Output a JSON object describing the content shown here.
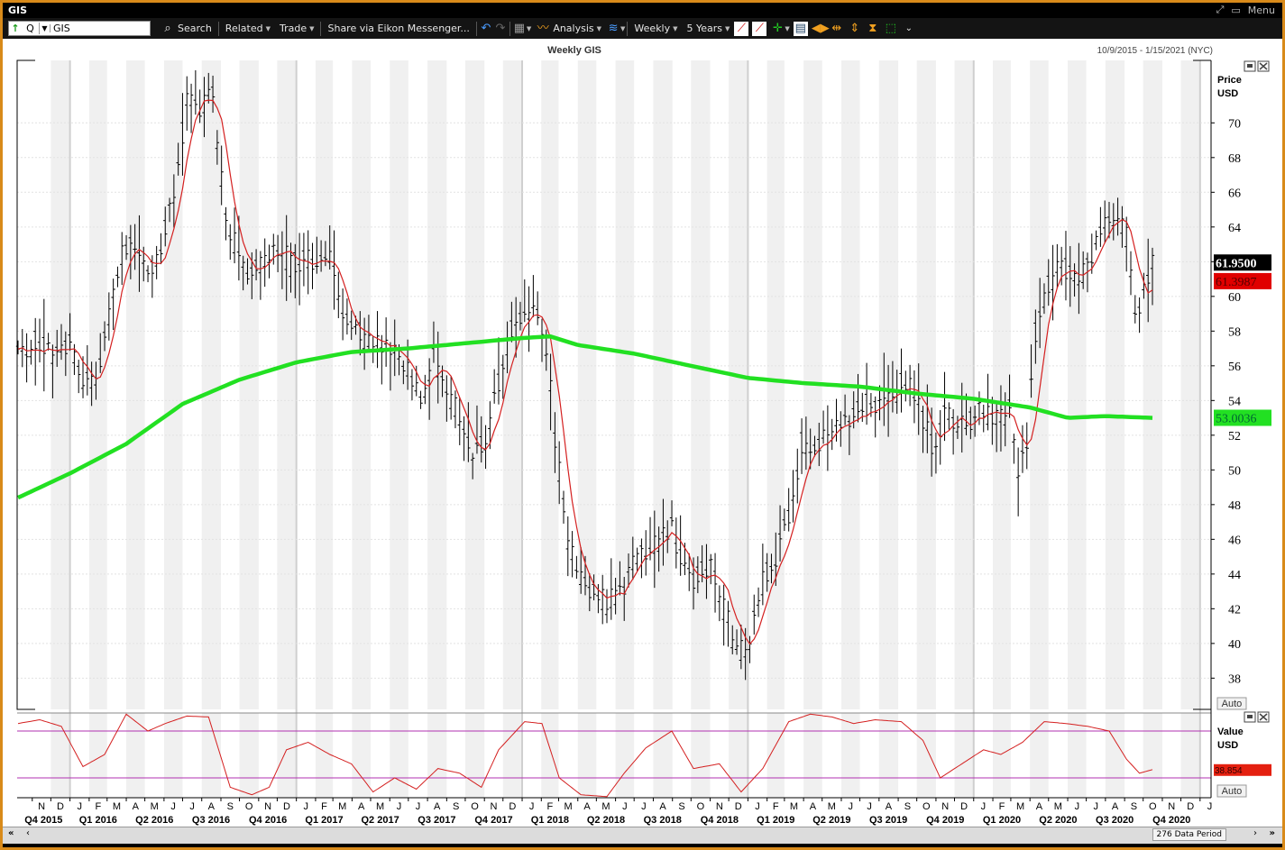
{
  "window": {
    "title": "GIS",
    "menu_label": "Menu"
  },
  "toolbar": {
    "ric_mode": "Q",
    "ric_value": "GIS",
    "search": "Search",
    "related": "Related",
    "trade": "Trade",
    "share": "Share via Eikon Messenger...",
    "analysis": "Analysis",
    "interval": "Weekly",
    "range": "5 Years"
  },
  "chart": {
    "title": "Weekly GIS",
    "date_range": "10/9/2015 - 1/15/2021 (NYC)",
    "price_axis_title": "Price",
    "price_axis_unit": "USD",
    "value_axis_title": "Value",
    "value_axis_unit": "USD",
    "auto_label": "Auto",
    "auto_label_lower": "Auto",
    "data_period": "276 Data Period",
    "last_price_label": "61.9500",
    "ma_short_label": "61.3987",
    "ma_long_label": "53.0036",
    "indicator_label": "38.854"
  },
  "colors": {
    "frame": "#d88a1a",
    "price_bars": "#000000",
    "ma_short": "#d42020",
    "ma_long": "#22e022",
    "indicator": "#d42020",
    "band_lines": "#b030b0",
    "last_price_bg": "#000000",
    "ma_short_bg": "#e00000",
    "ma_long_bg": "#22e022"
  },
  "chart_data": {
    "type": "ohlc",
    "interval": "weekly",
    "y_axis": {
      "ticks": [
        38,
        40,
        42,
        44,
        46,
        48,
        50,
        52,
        54,
        56,
        58,
        60,
        62,
        64,
        66,
        68,
        70
      ],
      "ylim": [
        36.2,
        73.6
      ]
    },
    "month_ticks": [
      "N",
      "D",
      "J",
      "F",
      "M",
      "A",
      "M",
      "J",
      "J",
      "A",
      "S",
      "O",
      "N",
      "D",
      "J",
      "F",
      "M",
      "A",
      "M",
      "J",
      "J",
      "A",
      "S",
      "O",
      "N",
      "D",
      "J",
      "F",
      "M",
      "A",
      "M",
      "J",
      "J",
      "A",
      "S",
      "O",
      "N",
      "D",
      "J",
      "F",
      "M",
      "A",
      "M",
      "J",
      "J",
      "A",
      "S",
      "O",
      "N",
      "D",
      "J",
      "F",
      "M",
      "A",
      "M",
      "J",
      "J",
      "A",
      "S",
      "O",
      "N",
      "D",
      "J",
      "F",
      "M",
      "A",
      "M",
      "J",
      "J",
      "A",
      "S",
      "O",
      "N",
      "D",
      "J"
    ],
    "quarter_ticks": [
      "Q4 2015",
      "Q1 2016",
      "Q2 2016",
      "Q3 2016",
      "Q4 2016",
      "Q1 2017",
      "Q2 2017",
      "Q3 2017",
      "Q4 2017",
      "Q1 2018",
      "Q2 2018",
      "Q3 2018",
      "Q4 2018",
      "Q1 2019",
      "Q2 2019",
      "Q3 2019",
      "Q4 2019",
      "Q1 2020",
      "Q2 2020",
      "Q3 2020",
      "Q4 2020"
    ],
    "price_anchors": [
      [
        "2015-10-09",
        56.5
      ],
      [
        "2015-11-06",
        57.4
      ],
      [
        "2015-12-04",
        56.5
      ],
      [
        "2016-01-01",
        57.6
      ],
      [
        "2016-01-22",
        55.0
      ],
      [
        "2016-02-12",
        55.2
      ],
      [
        "2016-03-04",
        59.0
      ],
      [
        "2016-03-25",
        62.5
      ],
      [
        "2016-04-15",
        63.0
      ],
      [
        "2016-05-06",
        61.0
      ],
      [
        "2016-05-27",
        63.0
      ],
      [
        "2016-06-17",
        65.5
      ],
      [
        "2016-07-08",
        71.5
      ],
      [
        "2016-07-29",
        70.8
      ],
      [
        "2016-08-19",
        71.5
      ],
      [
        "2016-09-09",
        64.5
      ],
      [
        "2016-09-30",
        62.5
      ],
      [
        "2016-10-21",
        61.3
      ],
      [
        "2016-11-11",
        62.3
      ],
      [
        "2016-12-02",
        63.0
      ],
      [
        "2016-12-23",
        61.8
      ],
      [
        "2017-01-13",
        62.2
      ],
      [
        "2017-02-03",
        62.0
      ],
      [
        "2017-02-24",
        62.5
      ],
      [
        "2017-03-17",
        59.3
      ],
      [
        "2017-04-07",
        58.0
      ],
      [
        "2017-04-28",
        57.5
      ],
      [
        "2017-05-19",
        56.8
      ],
      [
        "2017-06-09",
        56.9
      ],
      [
        "2017-06-30",
        56.0
      ],
      [
        "2017-07-21",
        54.0
      ],
      [
        "2017-08-11",
        56.5
      ],
      [
        "2017-09-01",
        54.5
      ],
      [
        "2017-09-22",
        53.0
      ],
      [
        "2017-10-13",
        51.0
      ],
      [
        "2017-11-03",
        51.5
      ],
      [
        "2017-11-24",
        55.0
      ],
      [
        "2017-12-15",
        58.0
      ],
      [
        "2018-01-05",
        58.5
      ],
      [
        "2018-01-26",
        59.0
      ],
      [
        "2018-02-09",
        57.0
      ],
      [
        "2018-02-23",
        52.0
      ],
      [
        "2018-03-16",
        45.5
      ],
      [
        "2018-04-06",
        44.0
      ],
      [
        "2018-04-27",
        43.0
      ],
      [
        "2018-05-18",
        42.2
      ],
      [
        "2018-06-08",
        43.0
      ],
      [
        "2018-06-29",
        44.5
      ],
      [
        "2018-07-20",
        45.5
      ],
      [
        "2018-08-10",
        46.0
      ],
      [
        "2018-08-31",
        46.8
      ],
      [
        "2018-09-21",
        44.0
      ],
      [
        "2018-10-12",
        43.8
      ],
      [
        "2018-11-02",
        44.5
      ],
      [
        "2018-11-23",
        42.0
      ],
      [
        "2018-12-14",
        39.5
      ],
      [
        "2019-01-04",
        40.0
      ],
      [
        "2019-01-25",
        43.5
      ],
      [
        "2019-02-15",
        45.0
      ],
      [
        "2019-03-08",
        47.5
      ],
      [
        "2019-03-29",
        51.5
      ],
      [
        "2019-04-19",
        51.0
      ],
      [
        "2019-05-10",
        52.0
      ],
      [
        "2019-05-31",
        52.5
      ],
      [
        "2019-06-21",
        53.5
      ],
      [
        "2019-07-12",
        53.8
      ],
      [
        "2019-08-02",
        54.0
      ],
      [
        "2019-08-23",
        54.2
      ],
      [
        "2019-09-13",
        55.3
      ],
      [
        "2019-10-04",
        53.5
      ],
      [
        "2019-10-25",
        51.5
      ],
      [
        "2019-11-15",
        53.0
      ],
      [
        "2019-12-06",
        52.8
      ],
      [
        "2019-12-27",
        53.0
      ],
      [
        "2020-01-17",
        53.3
      ],
      [
        "2020-02-07",
        52.8
      ],
      [
        "2020-02-28",
        53.5
      ],
      [
        "2020-03-13",
        50.0
      ],
      [
        "2020-03-27",
        51.5
      ],
      [
        "2020-04-10",
        58.0
      ],
      [
        "2020-05-01",
        60.5
      ],
      [
        "2020-05-22",
        62.0
      ],
      [
        "2020-06-12",
        61.0
      ],
      [
        "2020-07-03",
        61.5
      ],
      [
        "2020-07-24",
        64.0
      ],
      [
        "2020-08-14",
        64.5
      ],
      [
        "2020-09-04",
        63.5
      ],
      [
        "2020-09-18",
        58.8
      ],
      [
        "2020-10-02",
        60.5
      ],
      [
        "2020-10-16",
        61.95
      ]
    ],
    "ma_long_anchors": [
      [
        "2015-10-09",
        48.4
      ],
      [
        "2016-01-01",
        49.8
      ],
      [
        "2016-04-01",
        51.5
      ],
      [
        "2016-07-01",
        53.8
      ],
      [
        "2016-10-01",
        55.2
      ],
      [
        "2017-01-01",
        56.2
      ],
      [
        "2017-04-01",
        56.8
      ],
      [
        "2017-07-01",
        57.0
      ],
      [
        "2017-10-01",
        57.3
      ],
      [
        "2018-01-01",
        57.6
      ],
      [
        "2018-02-15",
        57.7
      ],
      [
        "2018-04-01",
        57.2
      ],
      [
        "2018-07-01",
        56.7
      ],
      [
        "2018-10-01",
        56.0
      ],
      [
        "2019-01-01",
        55.3
      ],
      [
        "2019-04-01",
        55.0
      ],
      [
        "2019-07-01",
        54.8
      ],
      [
        "2019-10-01",
        54.4
      ],
      [
        "2020-01-01",
        54.1
      ],
      [
        "2020-04-01",
        53.6
      ],
      [
        "2020-06-01",
        53.0
      ],
      [
        "2020-08-01",
        53.1
      ],
      [
        "2020-10-16",
        53.0
      ]
    ],
    "indicator_anchors": [
      [
        "2015-10-09",
        88
      ],
      [
        "2015-11-13",
        92
      ],
      [
        "2015-12-18",
        85
      ],
      [
        "2016-01-22",
        42
      ],
      [
        "2016-02-26",
        55
      ],
      [
        "2016-04-01",
        98
      ],
      [
        "2016-05-06",
        80
      ],
      [
        "2016-06-03",
        88
      ],
      [
        "2016-07-08",
        96
      ],
      [
        "2016-08-12",
        95
      ],
      [
        "2016-09-16",
        20
      ],
      [
        "2016-10-21",
        12
      ],
      [
        "2016-11-18",
        20
      ],
      [
        "2016-12-16",
        60
      ],
      [
        "2017-01-20",
        68
      ],
      [
        "2017-02-24",
        55
      ],
      [
        "2017-03-31",
        45
      ],
      [
        "2017-05-05",
        15
      ],
      [
        "2017-06-09",
        30
      ],
      [
        "2017-07-14",
        18
      ],
      [
        "2017-08-18",
        40
      ],
      [
        "2017-09-22",
        35
      ],
      [
        "2017-10-27",
        20
      ],
      [
        "2017-11-24",
        60
      ],
      [
        "2018-01-05",
        90
      ],
      [
        "2018-02-02",
        88
      ],
      [
        "2018-03-02",
        30
      ],
      [
        "2018-04-06",
        12
      ],
      [
        "2018-05-18",
        10
      ],
      [
        "2018-06-15",
        35
      ],
      [
        "2018-07-20",
        62
      ],
      [
        "2018-08-31",
        80
      ],
      [
        "2018-10-05",
        40
      ],
      [
        "2018-11-16",
        45
      ],
      [
        "2018-12-21",
        15
      ],
      [
        "2019-01-25",
        40
      ],
      [
        "2019-03-08",
        90
      ],
      [
        "2019-04-12",
        98
      ],
      [
        "2019-05-17",
        95
      ],
      [
        "2019-06-21",
        88
      ],
      [
        "2019-07-26",
        92
      ],
      [
        "2019-09-06",
        90
      ],
      [
        "2019-10-11",
        70
      ],
      [
        "2019-11-08",
        30
      ],
      [
        "2019-12-13",
        45
      ],
      [
        "2020-01-17",
        60
      ],
      [
        "2020-02-14",
        55
      ],
      [
        "2020-03-20",
        68
      ],
      [
        "2020-04-24",
        90
      ],
      [
        "2020-05-29",
        88
      ],
      [
        "2020-07-03",
        85
      ],
      [
        "2020-08-07",
        80
      ],
      [
        "2020-09-04",
        50
      ],
      [
        "2020-09-25",
        35
      ],
      [
        "2020-10-16",
        38.854
      ]
    ],
    "indicator_bands": [
      30,
      80
    ]
  }
}
